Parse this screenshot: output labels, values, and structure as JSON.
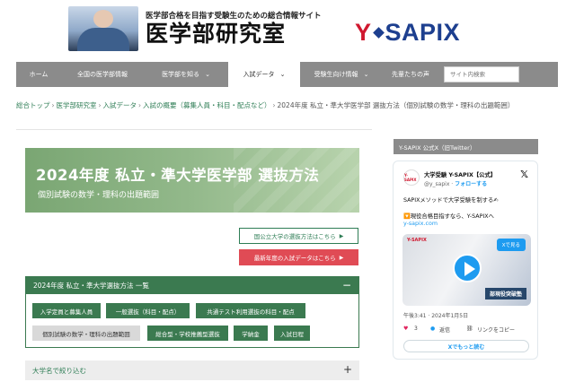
{
  "header": {
    "tagline": "医学部合格を目指す受験生のための総合情報サイト",
    "site_title": "医学部研究室",
    "partner_logo": {
      "left": "Y",
      "right": "SAPIX"
    }
  },
  "nav": {
    "items": [
      {
        "label": "ホーム",
        "chevron": false,
        "active": false
      },
      {
        "label": "全国の医学部情報",
        "chevron": false,
        "active": false
      },
      {
        "label": "医学部を知る",
        "chevron": true,
        "active": false
      },
      {
        "label": "入試データ",
        "chevron": true,
        "active": true
      },
      {
        "label": "受験生向け情報",
        "chevron": true,
        "active": false
      },
      {
        "label": "先輩たちの声",
        "chevron": false,
        "active": false
      }
    ],
    "search_placeholder": "サイト内検索"
  },
  "breadcrumb": {
    "items": [
      "総合トップ",
      "医学部研究室",
      "入試データ",
      "入試の概要（募集人員・科目・配点など）"
    ],
    "current": "2024年度 私立・準大学医学部 選抜方法（個別試験の数学・理科の出題範囲）",
    "separator": "›"
  },
  "hero": {
    "title": "2024年度 私立・準大学医学部 選抜方法",
    "subtitle": "個別試験の数学・理科の出題範囲"
  },
  "links": {
    "national": "国公立大学の選抜方法はこちら",
    "latest": "最新年度の入試データはこちら",
    "arrow": "▶"
  },
  "panel": {
    "title": "2024年度 私立・準大学選抜方法 一覧",
    "toggle": "−",
    "chips": [
      {
        "label": "入学定員と募集人員",
        "selected": false
      },
      {
        "label": "一般選抜（科目・配点）",
        "selected": false
      },
      {
        "label": "共通テスト利用選抜の科目・配点",
        "selected": false
      },
      {
        "label": "個別試験の数学・理科の出題範囲",
        "selected": true
      },
      {
        "label": "総合型・学校推薦型選抜",
        "selected": false
      },
      {
        "label": "学納金",
        "selected": false
      },
      {
        "label": "入試日程",
        "selected": false
      }
    ]
  },
  "filter": {
    "label": "大学名で絞り込む",
    "toggle": "+"
  },
  "sidebar": {
    "heading": "Y-SAPIX 公式X（旧Twitter）",
    "tweet": {
      "avatar_text": "Y-SAPIX",
      "name": "大学受験 Y-SAPIX【公式】",
      "handle": "@y_sapix",
      "follow": "フォローする",
      "x_logo": "𝕏",
      "body_line1": "SAPIXメソッドで大学受験を制する✍",
      "body_line2": "🔽現役合格目指すなら、Y-SAPIXへ",
      "link": "y-sapix.com",
      "media_brand": "Y-SAPIX",
      "media_button": "Xで見る",
      "media_banner": "部現役突破塾",
      "timestamp": "午後3:41 · 2024年1月5日",
      "likes": "3",
      "reply_label": "返信",
      "copy_label": "リンクをコピー",
      "read_more": "Xでもっと読む"
    }
  },
  "colors": {
    "green": "#3b7a50",
    "nav_gray": "#8b8b8b",
    "red": "#e04b55",
    "twitter_blue": "#1d9bf0"
  }
}
